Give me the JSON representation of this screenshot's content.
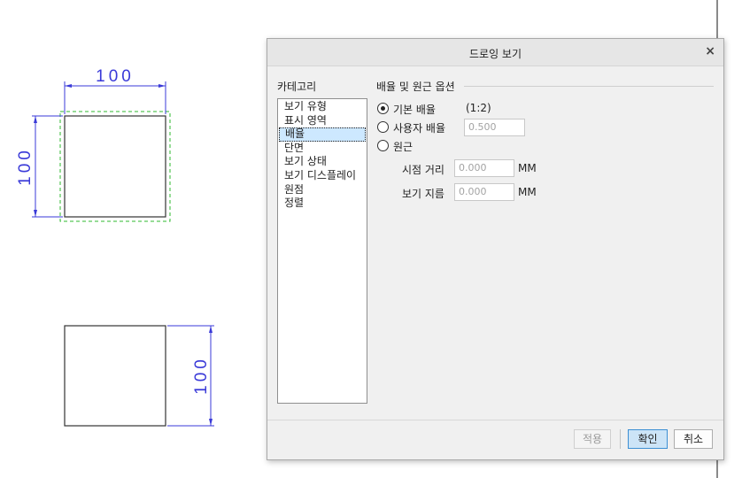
{
  "drawing": {
    "top_view_dim_horizontal": "100",
    "top_view_dim_vertical": "100",
    "bottom_view_dim_vertical": "100"
  },
  "dialog": {
    "title": "드로잉 보기",
    "close_glyph": "×",
    "category_label": "카테고리",
    "categories": [
      "보기 유형",
      "표시 영역",
      "배율",
      "단면",
      "보기 상태",
      "보기 디스플레이",
      "원점",
      "정렬"
    ],
    "selected_category": "배율",
    "group_title": "배율 및 원근 옵션",
    "options": {
      "default_scale_label": "기본 배율",
      "default_scale_value": "(1:2)",
      "custom_scale_label": "사용자 배율",
      "custom_scale_value": "0.500",
      "perspective_label": "원근",
      "selected": "기본 배율"
    },
    "perspective": {
      "view_distance_label": "시점 거리",
      "view_distance_value": "0.000",
      "view_diameter_label": "보기 지름",
      "view_diameter_value": "0.000",
      "unit": "MM"
    },
    "buttons": {
      "apply": "적용",
      "ok": "확인",
      "cancel": "취소"
    }
  }
}
